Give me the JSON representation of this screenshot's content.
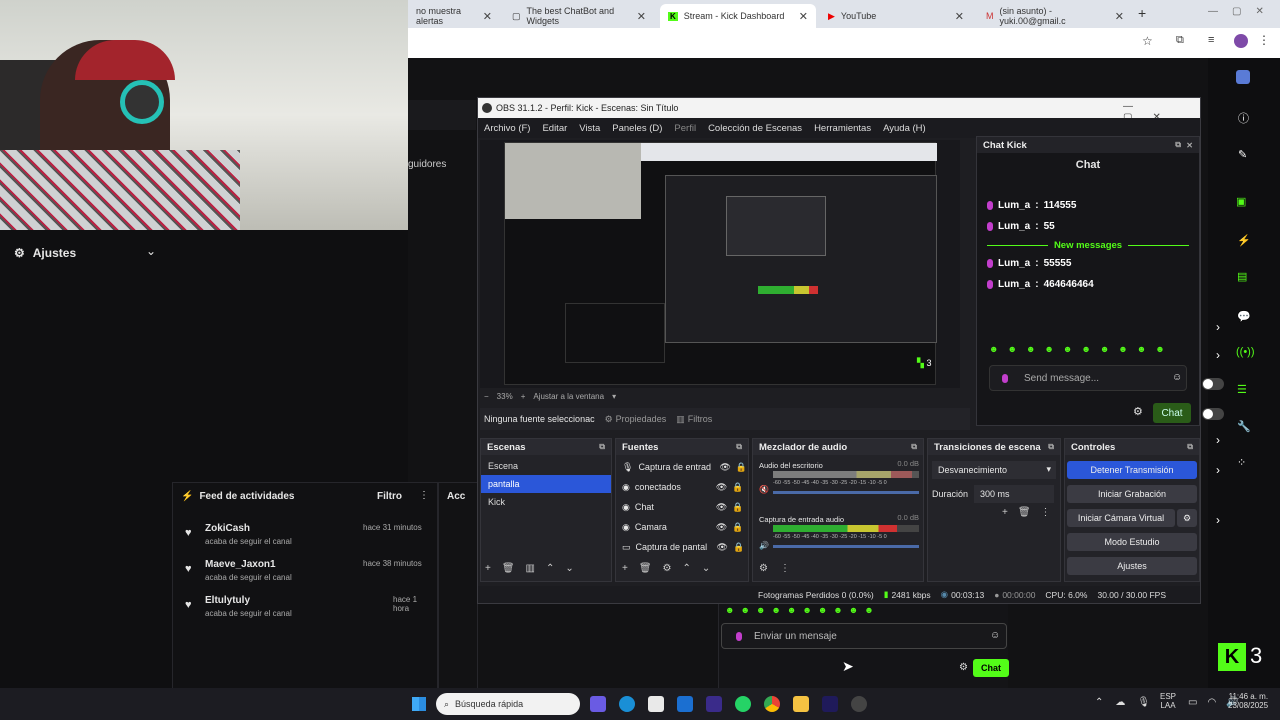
{
  "browser": {
    "tabs": [
      {
        "label": "no muestra alertas"
      },
      {
        "label": "The best ChatBot and Widgets"
      },
      {
        "label": "Stream - Kick Dashboard",
        "active": true
      },
      {
        "label": "YouTube"
      },
      {
        "label": "(sin asunto) - yuki.00@gmail.c"
      }
    ]
  },
  "kick_left": {
    "ajustes_label": "Ajustes",
    "seguidores_label": "guidores",
    "feed": {
      "title": "Feed de actividades",
      "filter_label": "Filtro",
      "acc_label": "Acc",
      "items": [
        {
          "user": "ZokiCash",
          "action": "acaba de seguir el canal",
          "time": "hace 31 minutos"
        },
        {
          "user": "Maeve_Jaxon1",
          "action": "acaba de seguir el canal",
          "time": "hace 38 minutos"
        },
        {
          "user": "Eltulytuly",
          "action": "acaba de seguir el canal",
          "time": "hace 1 hora"
        }
      ]
    }
  },
  "kick_bottom": {
    "placeholder": "Enviar un mensaje",
    "chat_label": "Chat",
    "badge_count": "3"
  },
  "obs": {
    "title": "OBS 31.1.2 - Perfil: Kick - Escenas: Sin Título",
    "menu": [
      "Archivo (F)",
      "Editar",
      "Vista",
      "Paneles (D)",
      "Perfil",
      "Colección de Escenas",
      "Herramientas",
      "Ayuda (H)"
    ],
    "preview": {
      "zoom": "33%",
      "fit_label": "Ajustar a la ventana",
      "mini_count": "3"
    },
    "source_bar": {
      "none_label": "Ninguna fuente seleccionac",
      "props_label": "Propiedades",
      "filters_label": "Filtros"
    },
    "scenes": {
      "title": "Escenas",
      "items": [
        {
          "label": "Escena"
        },
        {
          "label": "pantalla",
          "selected": true
        },
        {
          "label": "Kick"
        }
      ]
    },
    "sources": {
      "title": "Fuentes",
      "items": [
        {
          "label": "Captura de entrad"
        },
        {
          "label": "conectados"
        },
        {
          "label": "Chat"
        },
        {
          "label": "Camara"
        },
        {
          "label": "Captura de pantal"
        }
      ]
    },
    "mixer": {
      "title": "Mezclador de audio",
      "channels": [
        {
          "name": "Audio del escritorio",
          "db": "0.0 dB",
          "level": 0.0
        },
        {
          "name": "Captura de entrada audio",
          "db": "0.0 dB",
          "level": 0.85
        }
      ],
      "scale": "-60 -55 -50 -45 -40 -35 -30 -25 -20 -15 -10 -5 0"
    },
    "transitions": {
      "title": "Transiciones de escena",
      "type": "Desvanecimiento",
      "duration_label": "Duración",
      "duration": "300 ms"
    },
    "controls": {
      "title": "Controles",
      "buttons": [
        "Detener Transmisión",
        "Iniciar Grabación",
        "Iniciar Cámara Virtual",
        "Modo Estudio",
        "Ajustes"
      ]
    },
    "status": {
      "dropped": "Fotogramas Perdidos 0 (0.0%)",
      "kbps": "2481 kbps",
      "live_time": "00:03:13",
      "rec_time": "00:00:00",
      "cpu": "CPU: 6.0%",
      "fps": "30.00 / 30.00 FPS"
    }
  },
  "chat_dock": {
    "title": "Chat Kick",
    "header": "Chat",
    "messages": [
      {
        "user": "Lum_a",
        "text": "114555"
      },
      {
        "user": "Lum_a",
        "text": "55"
      }
    ],
    "divider": "New messages",
    "messages2": [
      {
        "user": "Lum_a",
        "text": "55555"
      },
      {
        "user": "Lum_a",
        "text": "464646464"
      }
    ],
    "placeholder": "Send message...",
    "chat_button": "Chat"
  },
  "taskbar": {
    "search": "Búsqueda rápida",
    "lang": "ESP",
    "lang2": "LAA",
    "time": "11:46 a. m.",
    "date": "23/08/2025"
  },
  "colors": {
    "kick_green": "#53fc18",
    "obs_blue": "#2b57d9"
  }
}
